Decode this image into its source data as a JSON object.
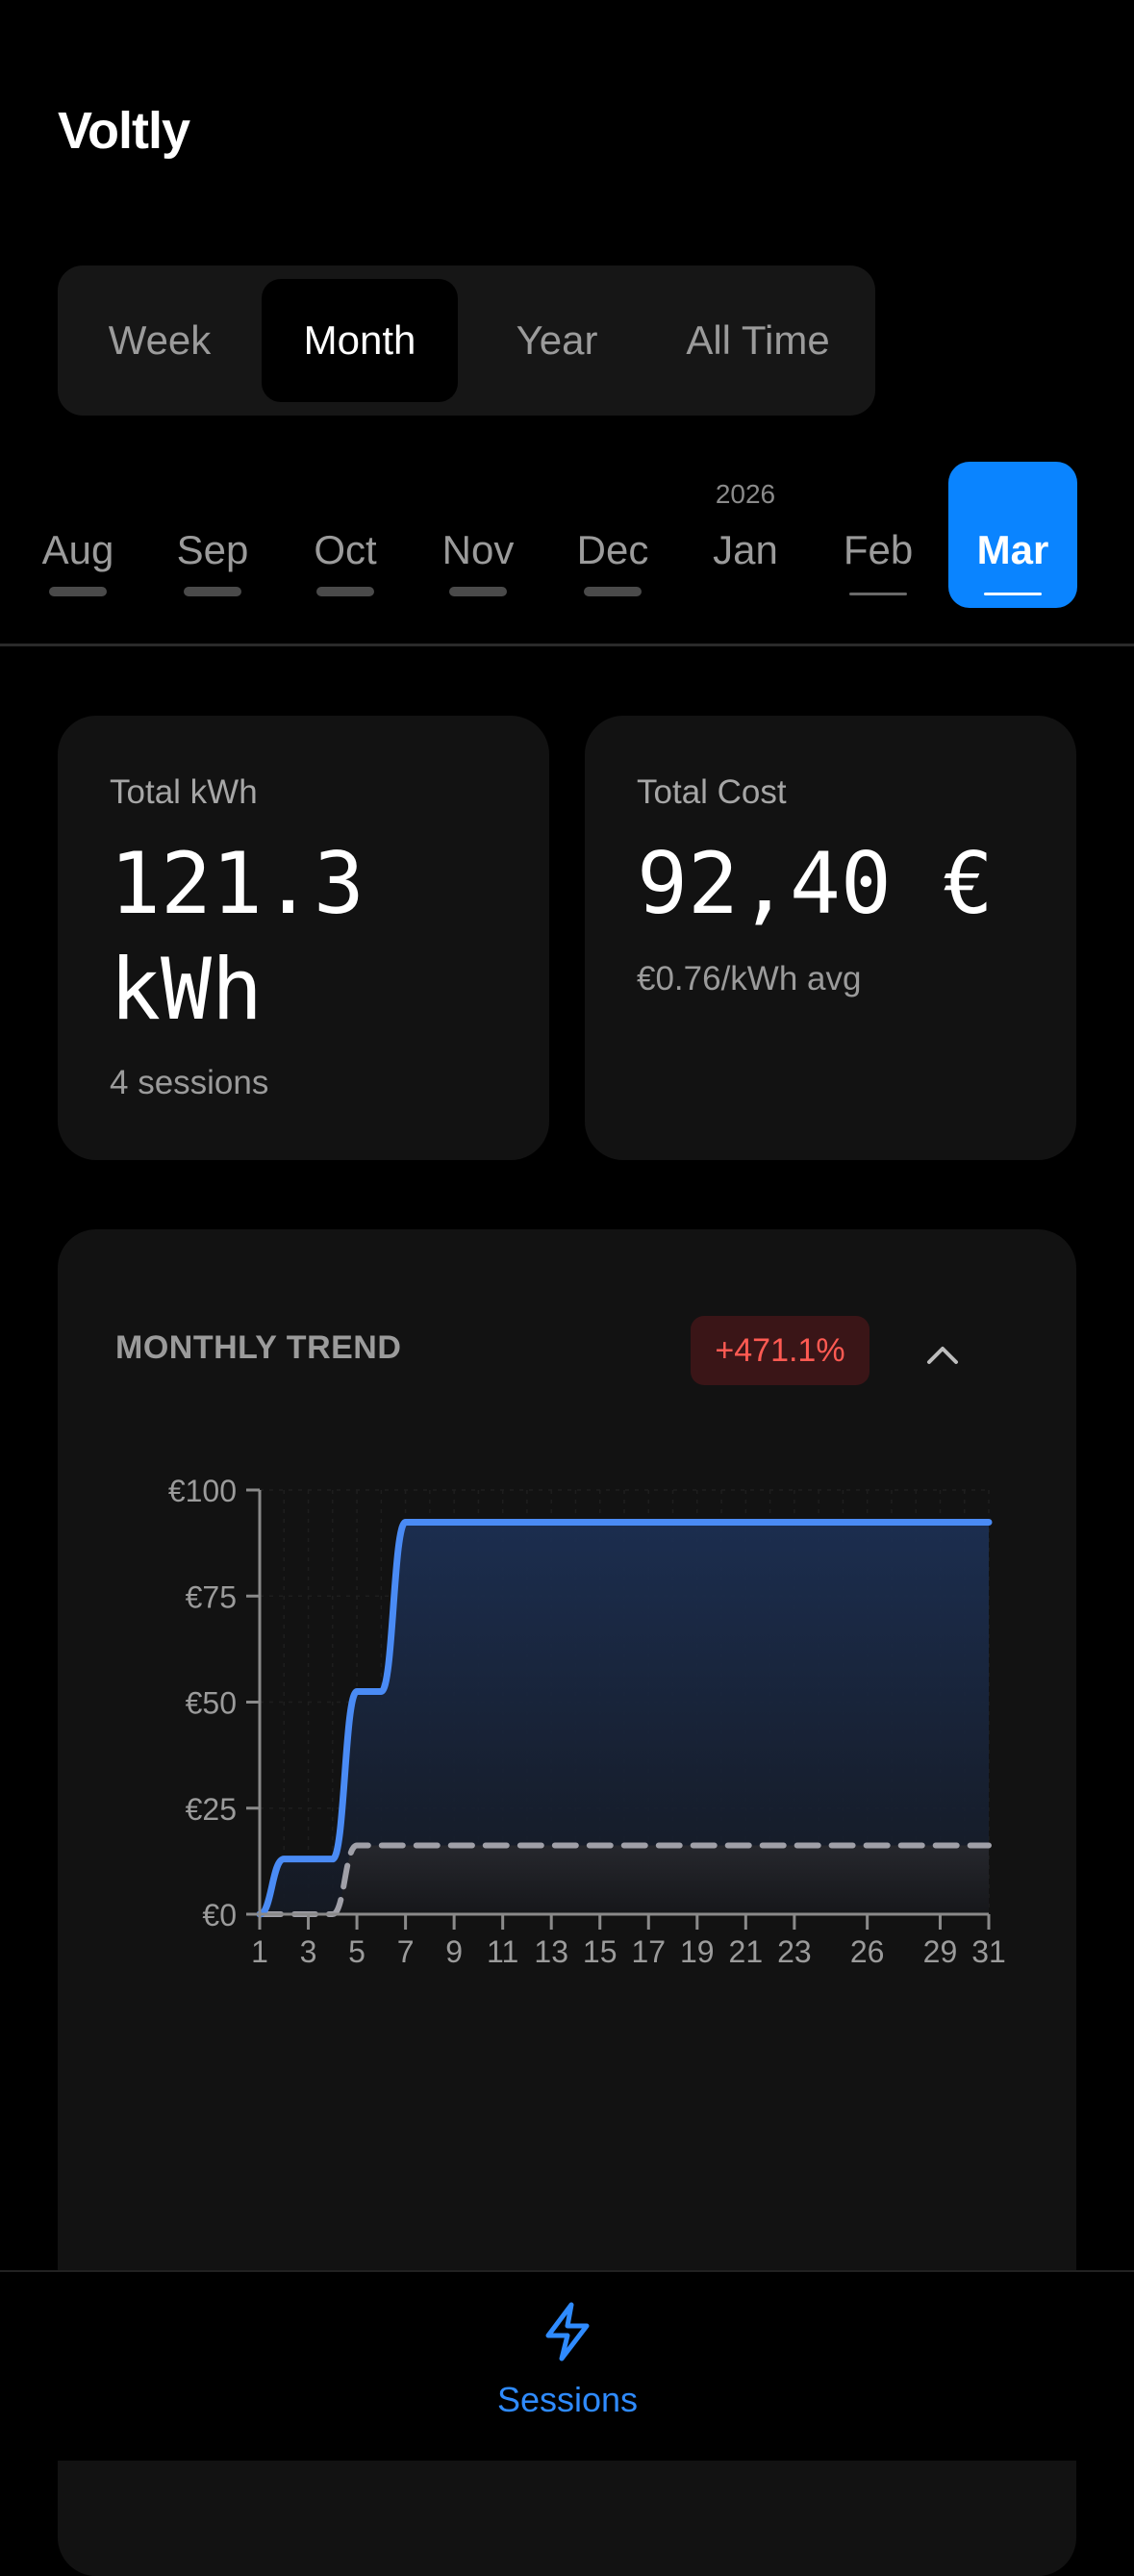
{
  "app": {
    "title": "Voltly"
  },
  "period_tabs": [
    "Week",
    "Month",
    "Year",
    "All Time"
  ],
  "period_selected": "Month",
  "months": [
    {
      "label": "Aug",
      "year": "",
      "has_data": true
    },
    {
      "label": "Sep",
      "year": "",
      "has_data": true
    },
    {
      "label": "Oct",
      "year": "",
      "has_data": true
    },
    {
      "label": "Nov",
      "year": "",
      "has_data": true
    },
    {
      "label": "Dec",
      "year": "",
      "has_data": true
    },
    {
      "label": "Jan",
      "year": "2026",
      "has_data": false
    },
    {
      "label": "Feb",
      "year": "",
      "has_data": false
    },
    {
      "label": "Mar",
      "year": "",
      "has_data": false,
      "selected": true
    }
  ],
  "summary": {
    "kwh": {
      "caption": "Total kWh",
      "value": "121.3 kWh",
      "sub": "4 sessions"
    },
    "cost": {
      "caption": "Total Cost",
      "value": "92,40 €",
      "sub": "€0.76/kWh avg"
    }
  },
  "trend": {
    "title": "MONTHLY TREND",
    "change": "+471.1%",
    "change_color": "#ff5a52",
    "collapse_icon": "chevron-up-icon"
  },
  "chart_data": {
    "type": "line",
    "title": "",
    "xlabel": "",
    "ylabel": "",
    "x_ticks": [
      1,
      3,
      5,
      7,
      9,
      11,
      13,
      15,
      17,
      19,
      21,
      23,
      26,
      29,
      31
    ],
    "y_ticks": [
      "€0",
      "€25",
      "€50",
      "€75",
      "€100"
    ],
    "ylim": [
      0,
      100
    ],
    "xlim": [
      1,
      31
    ],
    "grid": true,
    "series": [
      {
        "style": "solid",
        "color": "#4a8bf5",
        "points": [
          [
            1,
            0
          ],
          [
            2,
            13
          ],
          [
            4,
            13
          ],
          [
            5,
            52.5
          ],
          [
            6,
            52.5
          ],
          [
            7,
            92.4
          ],
          [
            31,
            92.4
          ]
        ]
      },
      {
        "style": "dashed",
        "color": "#a0a0a8",
        "points": [
          [
            1,
            0
          ],
          [
            4,
            0
          ],
          [
            5,
            16.2
          ],
          [
            31,
            16.2
          ]
        ]
      }
    ]
  },
  "bottom_nav": {
    "label": "Sessions",
    "icon": "lightning-bolt-icon",
    "color": "#2f8bff"
  }
}
